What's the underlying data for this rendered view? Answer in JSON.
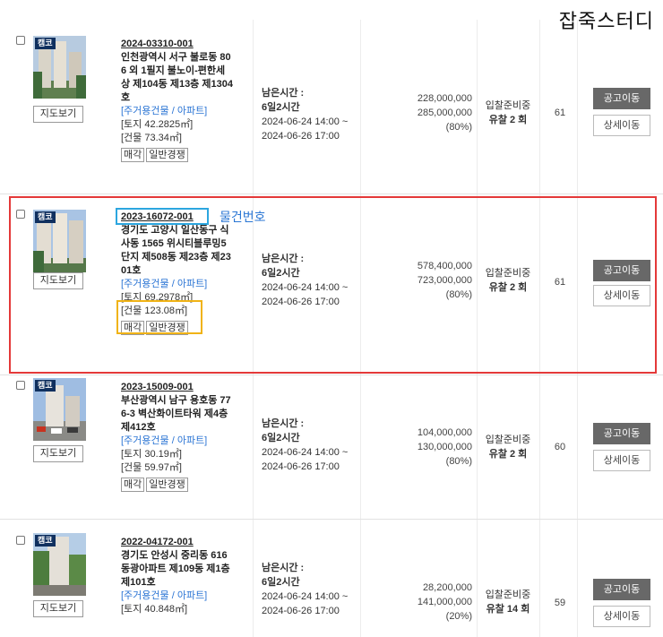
{
  "brand": "잡죽스터디",
  "listings": [
    {
      "badge": "캠코",
      "map_label": "지도보기",
      "case_no": "2024-03310-001",
      "address_lines": [
        "인천광역시 서구 불로동 80",
        "6 외 1필지 불노이-편한세",
        "상 제104동 제13층 제1304",
        "호"
      ],
      "type": "[주거용건물 / 아파트]",
      "land": "[토지 42.2825㎡]",
      "building": "[건물 73.34㎡]",
      "tags": [
        "매각",
        "일반경쟁"
      ],
      "remaining_label": "남은시간 :",
      "remaining": "6일2시간",
      "date_start": "2024-06-24 14:00 ~",
      "date_end": "2024-06-26 17:00",
      "appraisal": "228,000,000",
      "min_price": "285,000,000",
      "ratio": "(80%)",
      "status": "입찰준비중",
      "fail": "유찰 2 회",
      "views": "61",
      "notice_label": "공고이동",
      "detail_label": "상세이동"
    },
    {
      "badge": "캠코",
      "map_label": "지도보기",
      "case_no": "2023-16072-001",
      "address_lines": [
        "경기도 고양시 일산동구 식",
        "사동 1565 위시티블루밍5",
        "단지 제508동 제23층 제23",
        "01호"
      ],
      "type": "[주거용건물 / 아파트]",
      "land": "[토지 69.2978㎡]",
      "building": "[건물 123.08㎡]",
      "tags": [
        "매각",
        "일반경쟁"
      ],
      "remaining_label": "남은시간 :",
      "remaining": "6일2시간",
      "date_start": "2024-06-24 14:00 ~",
      "date_end": "2024-06-26 17:00",
      "appraisal": "578,400,000",
      "min_price": "723,000,000",
      "ratio": "(80%)",
      "status": "입찰준비중",
      "fail": "유찰 2 회",
      "views": "61",
      "notice_label": "공고이동",
      "detail_label": "상세이동",
      "annotation": "물건번호"
    },
    {
      "badge": "캠코",
      "map_label": "지도보기",
      "case_no": "2023-15009-001",
      "address_lines": [
        "부산광역시 남구 용호동 77",
        "6-3 벽산화이트타워 제4층",
        "제412호"
      ],
      "type": "[주거용건물 / 아파트]",
      "land": "[토지 30.19㎡]",
      "building": "[건물 59.97㎡]",
      "tags": [
        "매각",
        "일반경쟁"
      ],
      "remaining_label": "남은시간 :",
      "remaining": "6일2시간",
      "date_start": "2024-06-24 14:00 ~",
      "date_end": "2024-06-26 17:00",
      "appraisal": "104,000,000",
      "min_price": "130,000,000",
      "ratio": "(80%)",
      "status": "입찰준비중",
      "fail": "유찰 2 회",
      "views": "60",
      "notice_label": "공고이동",
      "detail_label": "상세이동"
    },
    {
      "badge": "캠코",
      "map_label": "지도보기",
      "case_no": "2022-04172-001",
      "address_lines": [
        "경기도 안성시 중리동 616",
        "동광아파트 제109동 제1층",
        "제101호"
      ],
      "type": "[주거용건물 / 아파트]",
      "land": "[토지 40.848㎡]",
      "building": "",
      "tags": [],
      "remaining_label": "남은시간 :",
      "remaining": "6일2시간",
      "date_start": "2024-06-24 14:00 ~",
      "date_end": "2024-06-26 17:00",
      "appraisal": "28,200,000",
      "min_price": "141,000,000",
      "ratio": "(20%)",
      "status": "입찰준비중",
      "fail": "유찰 14 회",
      "views": "59",
      "notice_label": "공고이동",
      "detail_label": "상세이동"
    }
  ]
}
